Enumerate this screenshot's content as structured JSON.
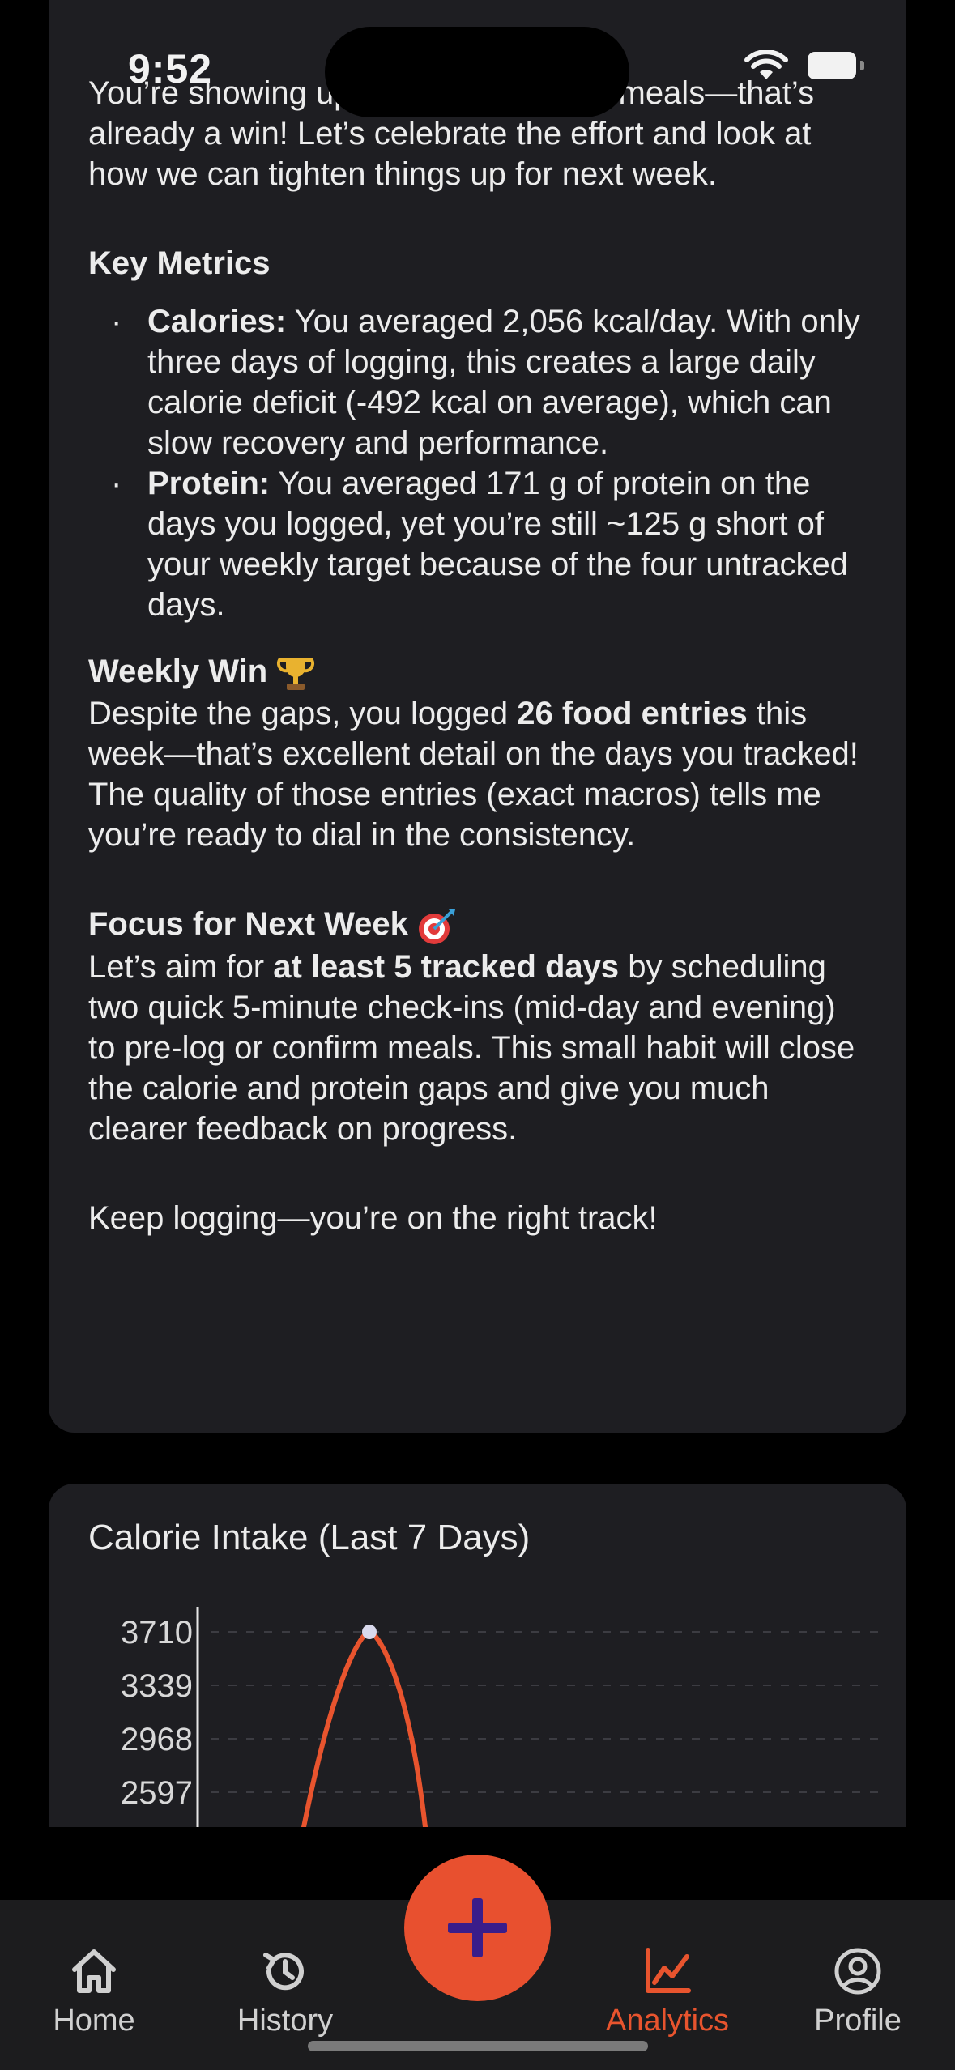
{
  "status_bar": {
    "time": "9:52"
  },
  "summary": {
    "intro": "You’re showing up and tracking your meals—that’s already a win! Let’s celebrate the effort and look at how we can tighten things up for next week.",
    "key_metrics_heading": "Key Metrics",
    "metrics": [
      {
        "label": "Calories:",
        "text": " You averaged 2,056 kcal/day. With only three days of logging, this creates a large daily calorie deficit (-492 kcal on average), which can slow recovery and performance."
      },
      {
        "label": "Protein:",
        "text": " You averaged 171 g of protein on the days you logged, yet you’re still ~125 g short of your weekly target because of the four untracked days."
      }
    ],
    "weekly_win_heading": "Weekly Win",
    "weekly_win_pre": "Despite the gaps, you logged ",
    "weekly_win_bold": "26 food entries",
    "weekly_win_post": " this week—that’s excellent detail on the days you tracked! The quality of those entries (exact macros) tells me you’re ready to dial in the consistency.",
    "focus_heading": "Focus for Next Week",
    "focus_pre": "Let’s aim for ",
    "focus_bold": "at least 5 tracked days",
    "focus_post": " by scheduling two quick 5-minute check-ins (mid-day and evening) to pre-log or confirm meals. This small habit will close the calorie and protein gaps and give you much clearer feedback on progress.",
    "closing": "Keep logging—you’re on the right track!"
  },
  "chart": {
    "title": "Calorie Intake (Last 7 Days)"
  },
  "chart_data": {
    "type": "line",
    "title": "Calorie Intake (Last 7 Days)",
    "y_ticks": [
      "3710",
      "3339",
      "2968",
      "2597"
    ],
    "ylim_visible": [
      2400,
      3710
    ],
    "peak_value": 3710,
    "line_color": "#e8542e",
    "grid": "dashed horizontal"
  },
  "fab": {
    "icon": "plus-icon",
    "color": "#e8502f"
  },
  "tabs": [
    {
      "label": "Home",
      "icon": "home-icon"
    },
    {
      "label": "History",
      "icon": "history-icon"
    },
    {
      "label": "Analytics",
      "icon": "analytics-icon",
      "active": true,
      "color": "#e8542e"
    },
    {
      "label": "Profile",
      "icon": "profile-icon"
    }
  ]
}
